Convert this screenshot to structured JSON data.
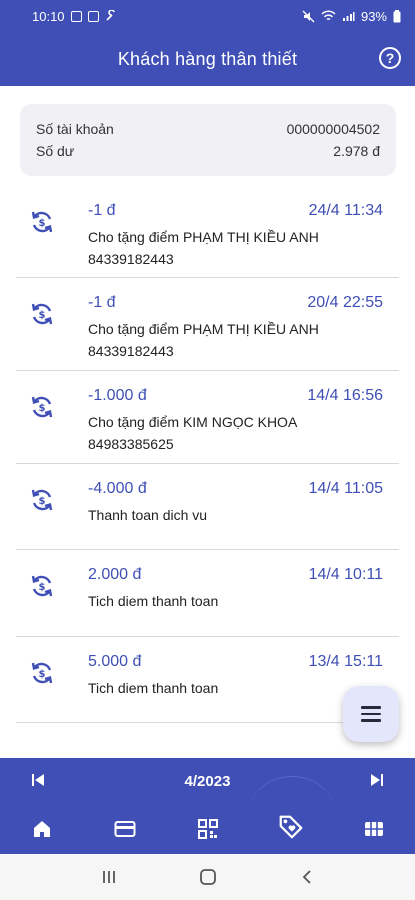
{
  "status_bar": {
    "time": "10:10",
    "battery": "93%"
  },
  "header": {
    "title": "Khách hàng thân thiết"
  },
  "account": {
    "number_label": "Số tài khoản",
    "number_value": "000000004502",
    "balance_label": "Số dư",
    "balance_value": "2.978 đ"
  },
  "transactions": [
    {
      "amount": "-1 đ",
      "date": "24/4 11:34",
      "desc": "Cho tặng điểm PHẠM THỊ KIỀU ANH 84339182443"
    },
    {
      "amount": "-1 đ",
      "date": "20/4 22:55",
      "desc": "Cho tặng điểm PHẠM THỊ KIỀU ANH 84339182443"
    },
    {
      "amount": "-1.000 đ",
      "date": "14/4 16:56",
      "desc": "Cho tặng điểm KIM NGỌC KHOA 84983385625"
    },
    {
      "amount": "-4.000 đ",
      "date": "14/4 11:05",
      "desc": "Thanh toan dich vu"
    },
    {
      "amount": "2.000 đ",
      "date": "14/4 10:11",
      "desc": "Tich diem thanh toan"
    },
    {
      "amount": "5.000 đ",
      "date": "13/4 15:11",
      "desc": "Tich diem thanh toan"
    }
  ],
  "month_nav": {
    "label": "4/2023"
  },
  "tabs": [
    "home-icon",
    "card-icon",
    "qr-code-icon",
    "loyalty-tag-icon",
    "grid-icon"
  ],
  "colors": {
    "primary": "#3f4fb5",
    "card_bg": "#f0f0f5",
    "fab_bg": "#e4e6fb"
  }
}
